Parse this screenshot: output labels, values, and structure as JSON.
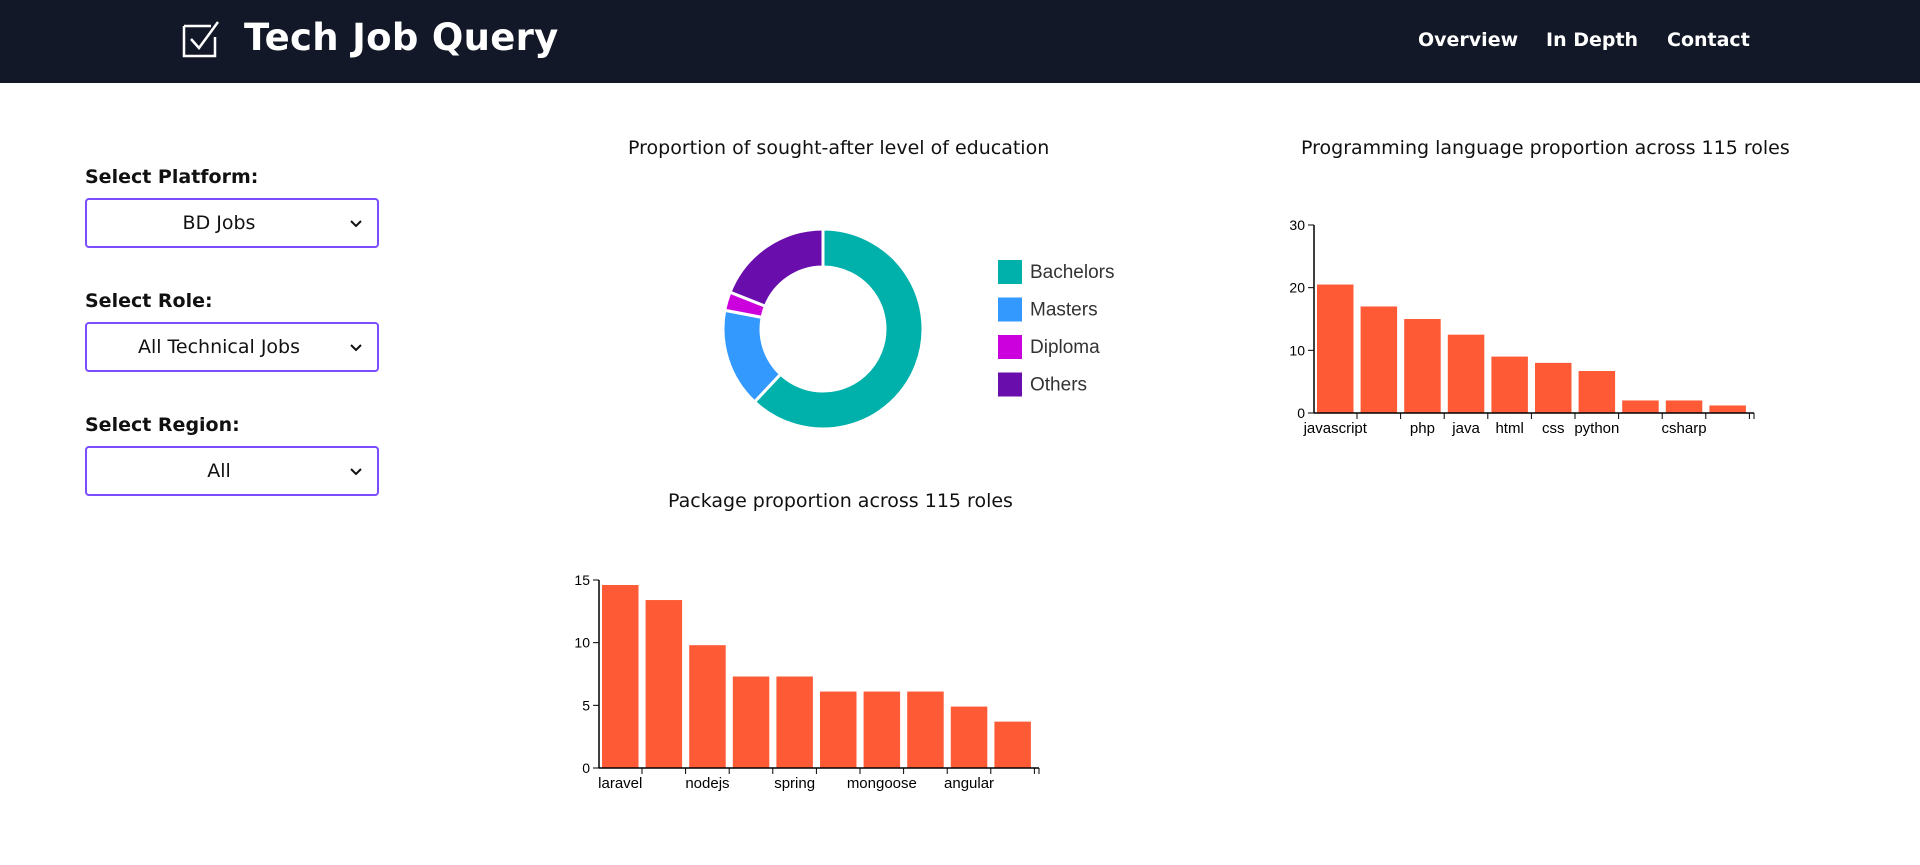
{
  "header": {
    "title": "Tech Job Query",
    "nav": [
      {
        "label": "Overview"
      },
      {
        "label": "In Depth"
      },
      {
        "label": "Contact"
      }
    ],
    "background": "#121828"
  },
  "filters": {
    "platform": {
      "label": "Select Platform:",
      "value": "BD Jobs"
    },
    "role": {
      "label": "Select Role:",
      "value": "All Technical Jobs"
    },
    "region": {
      "label": "Select Region:",
      "value": "All"
    },
    "accent": "#7c4dff"
  },
  "charts": {
    "education": {
      "title": "Proportion of sought-after level of education"
    },
    "languages": {
      "title": "Programming language proportion across 115 roles"
    },
    "packages": {
      "title": "Package proportion across 115 roles"
    }
  },
  "chart_data": [
    {
      "type": "pie",
      "subtype": "donut",
      "title": "Proportion of sought-after level of education",
      "categories": [
        "Bachelors",
        "Masters",
        "Diploma",
        "Others"
      ],
      "values": [
        62,
        16,
        3,
        19
      ],
      "colors": [
        "#00b0ab",
        "#3399ff",
        "#cc00dd",
        "#6a0dad"
      ],
      "legend_position": "right"
    },
    {
      "type": "bar",
      "title": "Programming language proportion across 115 roles",
      "categories": [
        "javascript",
        "",
        "php",
        "java",
        "html",
        "css",
        "python",
        "",
        "csharp",
        ""
      ],
      "values": [
        20.5,
        17,
        15,
        12.5,
        9,
        8,
        6.7,
        2,
        2,
        1.2
      ],
      "ylim": [
        0,
        30
      ],
      "yticks": [
        0,
        10,
        20,
        30
      ],
      "color": "#ff5a36"
    },
    {
      "type": "bar",
      "title": "Package proportion across 115 roles",
      "categories": [
        "laravel",
        "",
        "nodejs",
        "",
        "spring",
        "",
        "mongoose",
        "",
        "angular",
        ""
      ],
      "values": [
        14.6,
        13.4,
        9.8,
        7.3,
        7.3,
        6.1,
        6.1,
        6.1,
        4.9,
        3.7
      ],
      "ylim": [
        0,
        15
      ],
      "yticks": [
        0,
        5,
        10,
        15
      ],
      "color": "#ff5a36"
    }
  ]
}
